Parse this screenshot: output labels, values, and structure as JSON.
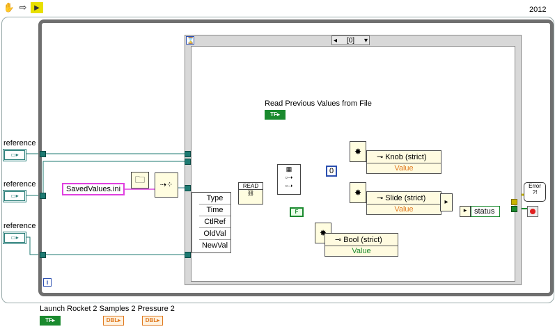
{
  "toolbar": {
    "run_icon": "hand-icon",
    "arrow_icon": "arrow-icon",
    "run_continuous_icon": "run-icon",
    "version": "2012"
  },
  "references": [
    {
      "label": "reference"
    },
    {
      "label": "reference"
    },
    {
      "label": "reference"
    }
  ],
  "constants": {
    "file_name": "SavedValues.ini",
    "zero": "0",
    "false_const": "F"
  },
  "case_structure": {
    "selector": "[0]",
    "comment": "Read Previous Values from File",
    "read_node": "READ"
  },
  "event_data": [
    "Type",
    "Time",
    "CtlRef",
    "OldVal",
    "NewVal"
  ],
  "property_nodes": [
    {
      "name": "Knob (strict)",
      "prop": "Value"
    },
    {
      "name": "Slide (strict)",
      "prop": "Value"
    },
    {
      "name": "Bool (strict)",
      "prop": "Value"
    }
  ],
  "status": {
    "label": "status"
  },
  "error_icon_text": "Error",
  "bottom_terminals": [
    {
      "label": "Launch Rocket 2",
      "type": "TF"
    },
    {
      "label": "Samples 2",
      "type": "DBL"
    },
    {
      "label": "Pressure 2",
      "type": "DBL"
    }
  ],
  "loop_iteration": "i",
  "colors": {
    "boolean": "#1a8a2e",
    "string": "#e040e0",
    "reference": "#2c7f7a",
    "double": "#e07a20",
    "error": "#c8b400"
  }
}
